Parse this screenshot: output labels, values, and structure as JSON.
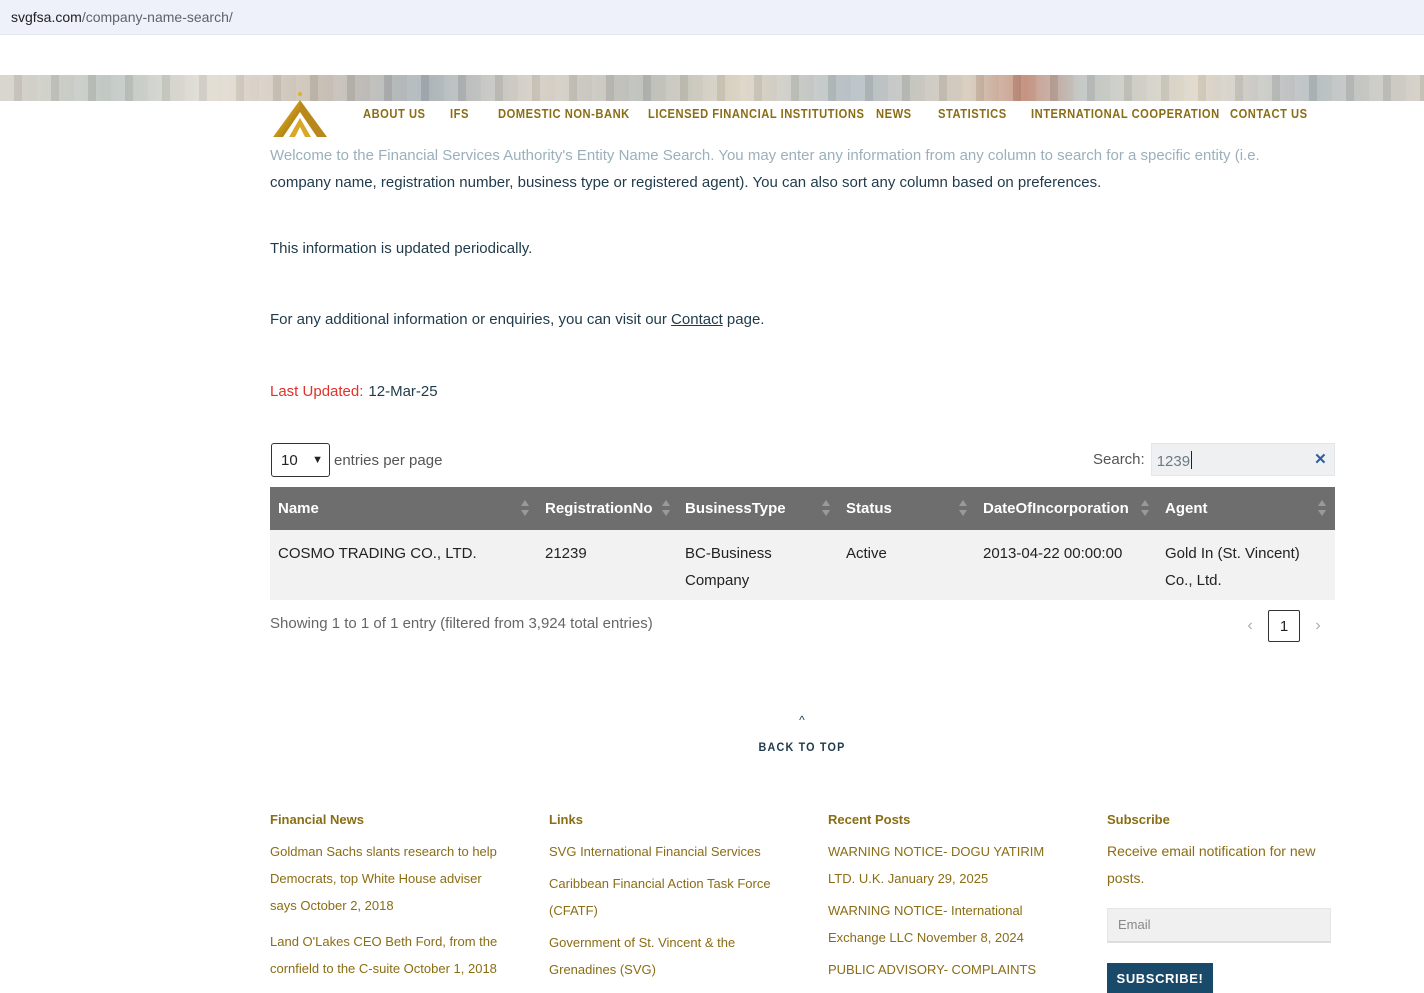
{
  "browser": {
    "url_domain": "svgfsa.com",
    "url_path": "/company-name-search/"
  },
  "nav": {
    "items": [
      "ABOUT US",
      "IFS",
      "DOMESTIC NON-BANK",
      "LICENSED FINANCIAL INSTITUTIONS",
      "NEWS",
      "STATISTICS",
      "INTERNATIONAL COOPERATION",
      "CONTACT US"
    ]
  },
  "intro": {
    "line1": "Welcome to the Financial Services Authority's Entity Name Search. You may enter any information from any column to search for a specific entity (i.e.",
    "line2": "company name, registration number, business type or registered agent). You can also sort any column based on preferences.",
    "updated_note": "This information is updated periodically.",
    "contact_prefix": "For any additional information or enquiries, you can visit our ",
    "contact_link": "Contact",
    "contact_suffix": " page.",
    "last_updated_label": "Last Updated:",
    "last_updated_value": "12-Mar-25"
  },
  "table_controls": {
    "entries_value": "10",
    "entries_label": "entries per page",
    "search_label": "Search:",
    "search_value": "1239",
    "clear_glyph": "✕"
  },
  "table": {
    "columns": [
      "Name",
      "RegistrationNo",
      "BusinessType",
      "Status",
      "DateOfIncorporation",
      "Agent"
    ],
    "rows": [
      {
        "name": "COSMO TRADING CO., LTD.",
        "registration_no": "21239",
        "business_type_line1": "BC-Business",
        "business_type_line2": "Company",
        "status": "Active",
        "date": "2013-04-22 00:00:00",
        "agent_line1": "Gold In (St. Vincent)",
        "agent_line2": "Co., Ltd."
      }
    ],
    "info": "Showing 1 to 1 of 1 entry (filtered from 3,924 total entries)",
    "pager": {
      "prev": "‹",
      "page": "1",
      "next": "›"
    }
  },
  "back_to_top": {
    "arrow": "^",
    "label": "BACK TO TOP"
  },
  "footer": {
    "financial_news": {
      "title": "Financial News",
      "items": [
        "Goldman Sachs slants research to help Democrats, top White House adviser says October 2, 2018",
        "Land O'Lakes CEO Beth Ford, from the cornfield to the C-suite October 1, 2018"
      ]
    },
    "links": {
      "title": "Links",
      "items": [
        "SVG International Financial Services",
        "Caribbean Financial Action Task Force (CFATF)",
        "Government of St. Vincent & the Grenadines (SVG)"
      ]
    },
    "recent_posts": {
      "title": "Recent Posts",
      "items": [
        "WARNING NOTICE- DOGU YATIRIM LTD. U.K. January 29, 2025",
        "WARNING NOTICE- International Exchange LLC November 8, 2024",
        "PUBLIC ADVISORY- COMPLAINTS"
      ]
    },
    "subscribe": {
      "title": "Subscribe",
      "text": "Receive email notification for new posts.",
      "email_placeholder": "Email",
      "button": "SUBSCRIBE!"
    }
  },
  "colors": {
    "accent_gold": "#8a6d14",
    "table_header": "#6e6e6e",
    "label_red": "#e0312a",
    "button_navy": "#1a4a6a"
  }
}
